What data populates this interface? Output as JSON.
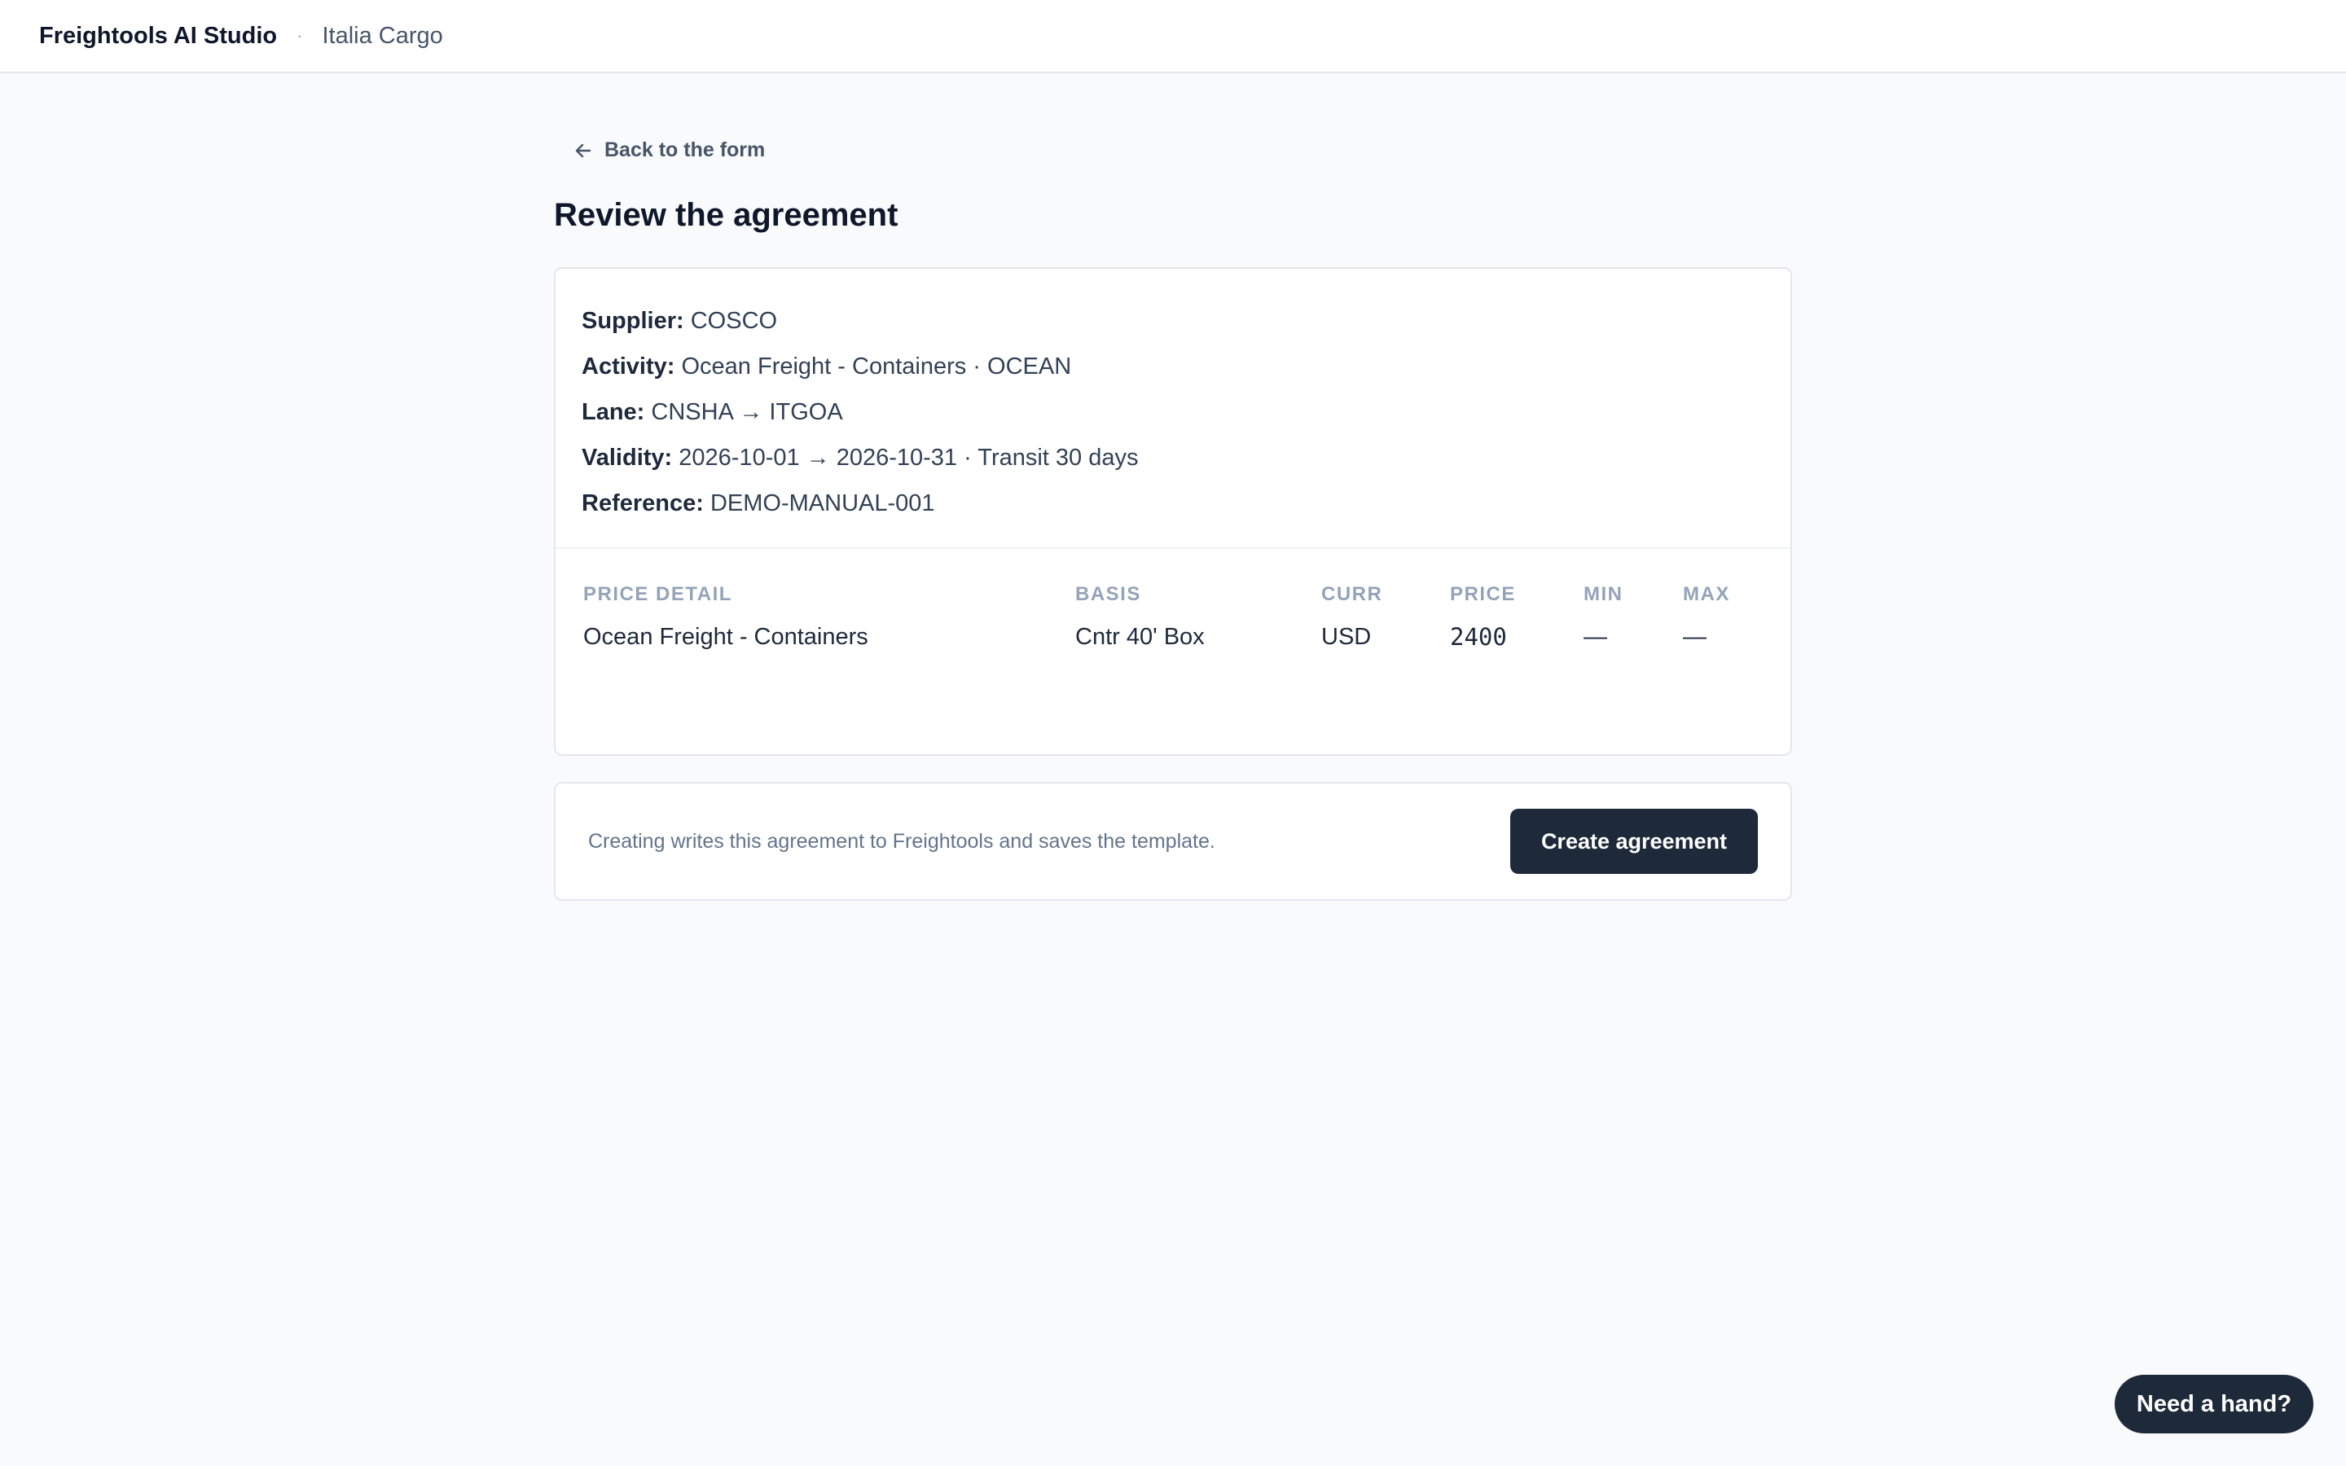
{
  "header": {
    "brand": "Freightools AI Studio",
    "separator": "·",
    "org": "Italia Cargo"
  },
  "nav": {
    "back_label": "Back to the form",
    "back_icon": "arrow-left-icon"
  },
  "page": {
    "title": "Review the agreement"
  },
  "summary": {
    "supplier_label": "Supplier:",
    "supplier_value": "COSCO",
    "activity_label": "Activity:",
    "activity_value": "Ocean Freight - Containers · OCEAN",
    "lane_label": "Lane:",
    "lane_value": "CNSHA → ITGOA",
    "validity_label": "Validity:",
    "validity_value": "2026-10-01 → 2026-10-31 · Transit 30 days",
    "reference_label": "Reference:",
    "reference_value": "DEMO-MANUAL-001"
  },
  "price_table": {
    "columns": [
      "PRICE DETAIL",
      "BASIS",
      "CURR",
      "PRICE",
      "MIN",
      "MAX"
    ],
    "rows": [
      [
        "Ocean Freight - Containers",
        "Cntr 40' Box",
        "USD",
        "2400",
        "—",
        "—"
      ]
    ]
  },
  "action": {
    "note": "Creating writes this agreement to Freightools and saves the template.",
    "create_label": "Create agreement"
  },
  "help": {
    "label": "Need a hand?"
  },
  "colors": {
    "background": "#f8fafc",
    "primary_button": "#1e2a3a",
    "heading": "#0f172a",
    "muted": "#94a3b8"
  }
}
